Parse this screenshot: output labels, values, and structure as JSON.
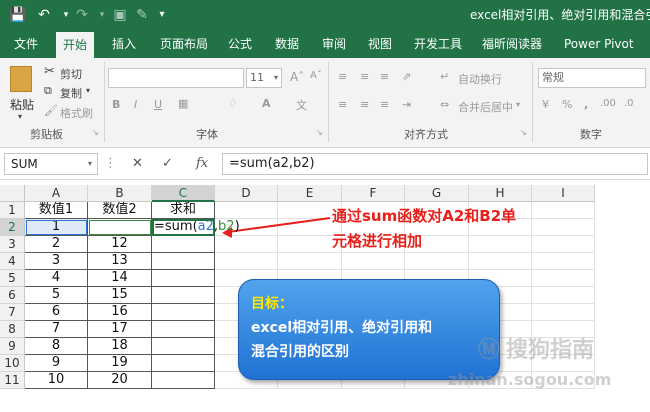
{
  "titlebar": {
    "title": "excel相对引用、绝对引用和混合引用的",
    "icons": [
      "save-icon",
      "undo-icon",
      "redo-icon",
      "print-preview-icon",
      "format-painter-icon",
      "customize-icon"
    ]
  },
  "tabs": [
    "文件",
    "开始",
    "插入",
    "页面布局",
    "公式",
    "数据",
    "审阅",
    "视图",
    "开发工具",
    "福昕阅读器",
    "Power Pivot"
  ],
  "active_tab": "开始",
  "ribbon": {
    "clipboard": {
      "paste": "粘贴",
      "cut": "剪切",
      "copy": "复制",
      "format_painter": "格式刷",
      "label": "剪贴板"
    },
    "font": {
      "size": "11",
      "label": "字体"
    },
    "alignment": {
      "wrap": "自动换行",
      "merge": "合并后居中",
      "label": "对齐方式"
    },
    "number": {
      "format": "常规",
      "label": "数字"
    }
  },
  "formula_bar": {
    "name_box": "SUM",
    "fx": "fx",
    "formula": "=sum(a2,b2)"
  },
  "columns": [
    "A",
    "B",
    "C",
    "D",
    "E",
    "F",
    "G",
    "H",
    "I"
  ],
  "rows": [
    "1",
    "2",
    "3",
    "4",
    "5",
    "6",
    "7",
    "8",
    "9",
    "10",
    "11"
  ],
  "cells": {
    "A1": "数值1",
    "B1": "数值2",
    "C1": "求和",
    "A2": "1",
    "A3": "2",
    "B3": "12",
    "A4": "3",
    "B4": "13",
    "A5": "4",
    "B5": "14",
    "A6": "5",
    "B6": "15",
    "A7": "6",
    "B7": "16",
    "A8": "7",
    "B8": "17",
    "A9": "8",
    "B9": "18",
    "A10": "9",
    "B10": "19",
    "A11": "10",
    "B11": "20"
  },
  "edit_cell": {
    "prefix": "=sum(",
    "ref1": "a2",
    "comma": ",",
    "ref2": "b2",
    "suffix": ")"
  },
  "annotation": {
    "line1": "通过sum函数对A2和B2单",
    "line2": "元格进行相加"
  },
  "note_bubble": {
    "line1": "目标：",
    "line2": "excel相对引用、绝对引用和",
    "line3": "混合引用的区别"
  },
  "watermark": {
    "brand": "搜狗指南",
    "url": "zhinan.sogou.com"
  },
  "colors": {
    "excel_green": "#217346",
    "annotation_red": "#e8201b",
    "bubble_blue": "#2f86e0",
    "ref_blue": "#2e75d6",
    "ref_green": "#3a8c3a"
  }
}
